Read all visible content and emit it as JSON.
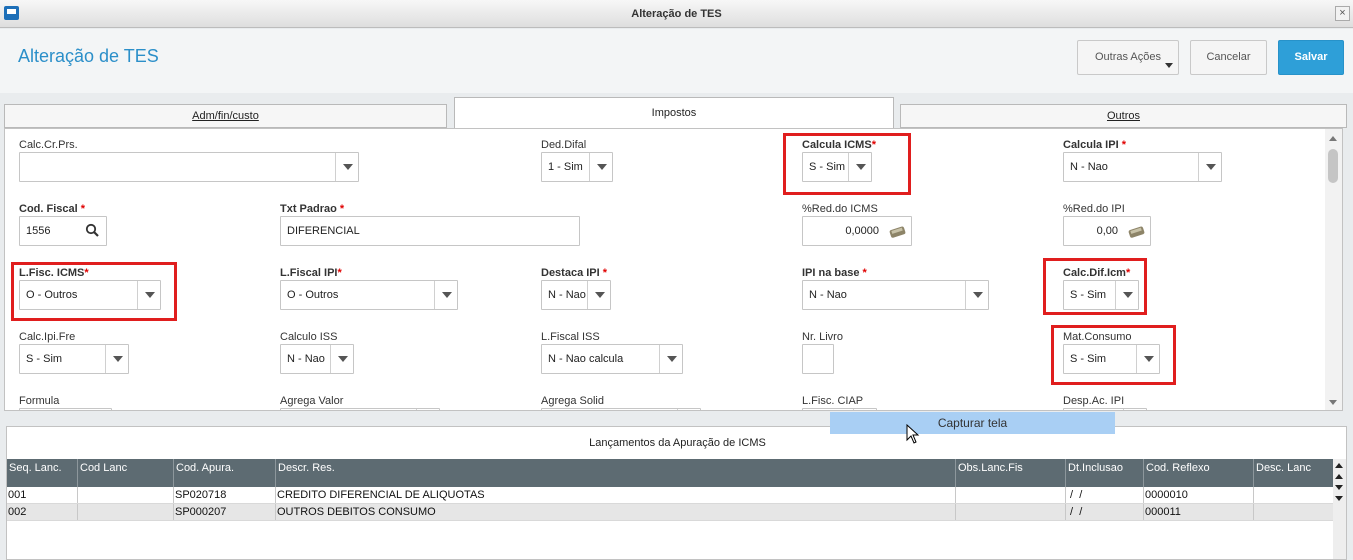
{
  "window": {
    "title": "Alteração de TES"
  },
  "header": {
    "title": "Alteração de TES",
    "more_actions": "Outras Ações",
    "cancel": "Cancelar",
    "save": "Salvar"
  },
  "tabs": {
    "adm": "Adm/fin/custo",
    "impostos": "Impostos",
    "outros": "Outros"
  },
  "form": {
    "calc_cr_prs": {
      "label": "Calc.Cr.Prs.",
      "value": ""
    },
    "ded_difal": {
      "label": "Ded.Difal",
      "value": "1 - Sim"
    },
    "calcula_icms": {
      "label": "Calcula ICMS",
      "value": "S - Sim"
    },
    "calcula_ipi": {
      "label": "Calcula IPI ",
      "value": "N - Nao"
    },
    "cod_fiscal": {
      "label": "Cod. Fiscal ",
      "value": "1556"
    },
    "txt_padrao": {
      "label": "Txt Padrao ",
      "value": "DIFERENCIAL"
    },
    "red_icms": {
      "label": "%Red.do ICMS",
      "value": "0,0000"
    },
    "red_ipi": {
      "label": "%Red.do IPI",
      "value": "0,00"
    },
    "lfisc_icms": {
      "label": "L.Fisc. ICMS",
      "value": "O - Outros"
    },
    "lfiscal_ipi": {
      "label": "L.Fiscal IPI",
      "value": "O - Outros"
    },
    "destaca_ipi": {
      "label": "Destaca IPI ",
      "value": "N - Nao"
    },
    "ipi_na_base": {
      "label": "IPI na base ",
      "value": "N - Nao"
    },
    "calc_dif_icm": {
      "label": "Calc.Dif.Icm",
      "value": "S - Sim"
    },
    "calc_ipi_fre": {
      "label": "Calc.Ipi.Fre",
      "value": "S - Sim"
    },
    "calculo_iss": {
      "label": "Calculo ISS",
      "value": "N - Nao"
    },
    "lfiscal_iss": {
      "label": "L.Fiscal ISS",
      "value": "N - Nao calcula"
    },
    "nr_livro": {
      "label": "Nr. Livro",
      "value": ""
    },
    "mat_consumo": {
      "label": "Mat.Consumo",
      "value": "S - Sim"
    },
    "formula": {
      "label": "Formula"
    },
    "agrega_valor": {
      "label": "Agrega Valor"
    },
    "agrega_solid": {
      "label": "Agrega Solid"
    },
    "lfisc_ciap": {
      "label": "L.Fisc. CIAP"
    },
    "desp_ac_ipi": {
      "label": "Desp.Ac. IPI"
    },
    "required_mark": "*"
  },
  "capture": {
    "label": "Capturar tela"
  },
  "grid": {
    "title": "Lançamentos da Apuração de ICMS",
    "columns": [
      "Seq. Lanc.",
      "Cod Lanc",
      "Cod. Apura.",
      "Descr. Res.",
      "Obs.Lanc.Fis",
      "Dt.Inclusao",
      "Cod. Reflexo",
      "Desc. Lanc"
    ],
    "rows": [
      [
        "001",
        "",
        "SP020718",
        "CREDITO DIFERENCIAL DE ALIQUOTAS",
        "",
        " /  /",
        "0000010",
        ""
      ],
      [
        "002",
        "",
        "SP000207",
        "OUTROS DEBITOS CONSUMO",
        "",
        " /  /",
        "000011",
        ""
      ]
    ]
  }
}
